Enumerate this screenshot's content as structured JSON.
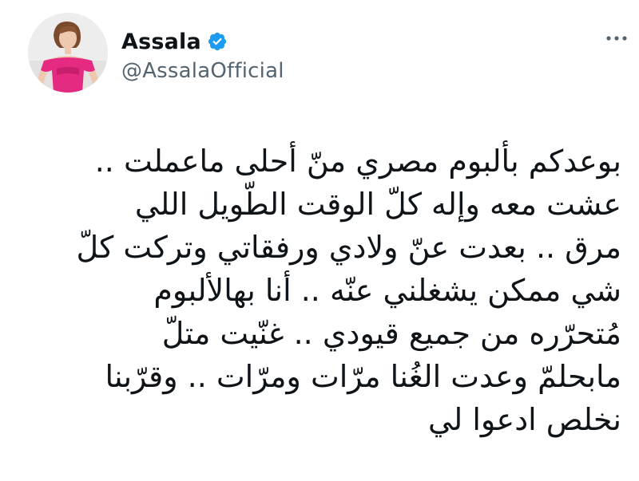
{
  "author": {
    "display_name": "Assala",
    "handle": "@AssalaOfficial",
    "verified": true,
    "avatar_icon": "profile-photo",
    "verified_icon": "verified-badge-icon",
    "verified_color": "#1d9bf0"
  },
  "more_icon": "more-options-icon",
  "tweet": {
    "lines": [
      "بوعدكم بألبوم مصري منّ أحلى ماعملت ..",
      "عشت معه وإله كلّ الوقت الطّويل اللي",
      "مرق .. بعدت عنّ ولادي ورفقاتي وتركت كلّ",
      "شي ممكن يشغلني عنّه .. أنا بهالألبوم",
      "مُتحرّره من جميع قيودي .. غنّيت متلّ",
      "مابحلمّ وعدت الغُنا مرّات ومرّات .. وقرّبنا",
      "نخلص ادعوا لي"
    ]
  }
}
